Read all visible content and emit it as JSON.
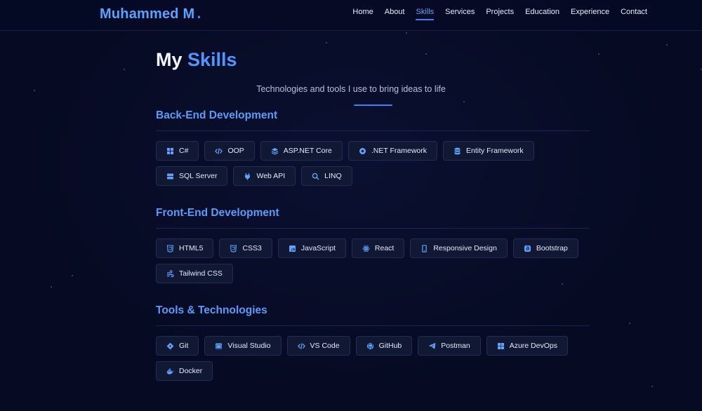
{
  "header": {
    "logo": "Muhammed M",
    "logo_dot": ".",
    "nav": [
      {
        "label": "Home",
        "id": "home"
      },
      {
        "label": "About",
        "id": "about"
      },
      {
        "label": "Skills",
        "id": "skills",
        "active": true
      },
      {
        "label": "Services",
        "id": "services"
      },
      {
        "label": "Projects",
        "id": "projects"
      },
      {
        "label": "Education",
        "id": "education"
      },
      {
        "label": "Experience",
        "id": "experience"
      },
      {
        "label": "Contact",
        "id": "contact"
      }
    ]
  },
  "hero": {
    "title_prefix": "My",
    "title_accent": "Skills",
    "subtitle": "Technologies and tools I use to bring ideas to life"
  },
  "sections": [
    {
      "title": "Back-End Development",
      "skills": [
        {
          "label": "C#",
          "icon": "grid-icon"
        },
        {
          "label": "OOP",
          "icon": "code-icon"
        },
        {
          "label": "ASP.NET Core",
          "icon": "layers-icon"
        },
        {
          "label": ".NET Framework",
          "icon": "circle-dot-icon"
        },
        {
          "label": "Entity Framework",
          "icon": "database-icon"
        },
        {
          "label": "SQL Server",
          "icon": "server-icon"
        },
        {
          "label": "Web API",
          "icon": "plug-icon"
        },
        {
          "label": "LINQ",
          "icon": "search-icon"
        }
      ]
    },
    {
      "title": "Front-End Development",
      "skills": [
        {
          "label": "HTML5",
          "icon": "html5-icon"
        },
        {
          "label": "CSS3",
          "icon": "css3-icon"
        },
        {
          "label": "JavaScript",
          "icon": "js-icon"
        },
        {
          "label": "React",
          "icon": "react-icon"
        },
        {
          "label": "Responsive Design",
          "icon": "mobile-icon"
        },
        {
          "label": "Bootstrap",
          "icon": "bootstrap-icon"
        },
        {
          "label": "Tailwind CSS",
          "icon": "wind-icon"
        }
      ]
    },
    {
      "title": "Tools & Technologies",
      "skills": [
        {
          "label": "Git",
          "icon": "git-icon"
        },
        {
          "label": "Visual Studio",
          "icon": "window-icon"
        },
        {
          "label": "VS Code",
          "icon": "code-icon"
        },
        {
          "label": "GitHub",
          "icon": "github-icon"
        },
        {
          "label": "Postman",
          "icon": "paper-plane-icon"
        },
        {
          "label": "Azure DevOps",
          "icon": "windows-icon"
        },
        {
          "label": "Docker",
          "icon": "docker-icon"
        }
      ]
    }
  ],
  "colors": {
    "accent": "#3b82f6",
    "heading": "#5a9cf8",
    "background": "#060a24"
  }
}
